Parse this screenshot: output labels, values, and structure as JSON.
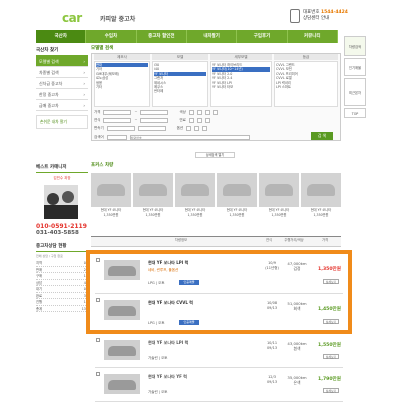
{
  "header": {
    "logo": "car",
    "logo_sub": "카피알 중고차",
    "tel_label": "대표번호",
    "tel": "1544-4424",
    "tel_note": "상담센터 안내"
  },
  "nav": [
    "국산차",
    "수입차",
    "중고차 할인전",
    "내차팔기",
    "구입후기",
    "커뮤니티"
  ],
  "left": {
    "title": "국산차 찾기",
    "items": [
      "모델별 검색",
      "차종별 검색",
      "신차급 중고차",
      "한정 중고차",
      "급매 중고차"
    ],
    "side_title": "손쉬운 내차 팔기",
    "best_title": "베스트 카매니저",
    "best_name": "김민수 과장",
    "phone1": "010-0591-2119",
    "phone2": "031-403-5858",
    "consult_title": "중고차상담 현황",
    "consult_sub": "전체 상담 / 구입 완료",
    "stats": [
      [
        "지역",
        "00"
      ],
      [
        "판매",
        "23"
      ],
      [
        "구매",
        "12"
      ],
      [
        "상담",
        "45"
      ],
      [
        "대기",
        "08"
      ],
      [
        "완료",
        "31"
      ],
      [
        "진행",
        "17"
      ],
      [
        "총계",
        "136"
      ]
    ]
  },
  "search": {
    "title": "모델별 검색",
    "cols": [
      "제조사",
      "모델",
      "세부모델",
      "등급"
    ],
    "makers": [
      "현대",
      "기아",
      "GM대우(쉐보레)",
      "르노삼성",
      "쌍용",
      "기타"
    ],
    "models": [
      "i30",
      "i40",
      "YF 쏘나타",
      "그랜저",
      "제네시스",
      "에쿠스",
      "싼타페"
    ],
    "details": [
      "YF 쏘나타 하이브리드",
      "YF 쏘나타(10~14년)",
      "YF 쏘나타 2.0",
      "YF 쏘나타 2.4",
      "YF 쏘나타 LPI",
      "YF 쏘나타 터보"
    ],
    "grades": [
      "CVVL 그랜드",
      "CVVL 모던",
      "CVVL 프리미어",
      "CVVL 로열",
      "LPI 럭셔리",
      "LPI 스마트"
    ],
    "price_label": "가격",
    "year_label": "연식",
    "color_label": "색상",
    "fuel_label": "연료",
    "gear_label": "변속기",
    "option_label": "옵션",
    "keyword_label": "검색어",
    "keyword_placeholder": "차량번호",
    "btn": "검 색",
    "more_btn": "상세검색 열기"
  },
  "photos": {
    "title": "포커스 차량",
    "items": [
      [
        "현대 YF 쏘나타",
        "1,350만원"
      ],
      [
        "현대 YF 쏘나타",
        "1,350만원"
      ],
      [
        "현대 YF 쏘나타",
        "1,350만원"
      ],
      [
        "현대 YF 쏘나타",
        "1,350만원"
      ],
      [
        "현대 YF 쏘나타",
        "1,350만원"
      ],
      [
        "현대 YF 쏘나타",
        "1,350만원"
      ]
    ]
  },
  "table": {
    "cols": [
      "차량정보",
      "연식",
      "주행거리/색상",
      "가격"
    ],
    "rows": [
      {
        "name": "현대 YF 쏘나타 LPI 럭",
        "opt": "네비, 썬루프, 풀옵션",
        "fuel": "LPG | 오토",
        "badge": "인증매물",
        "yr": "10/9\n(11년형)",
        "km": "47,000km\n검정",
        "price": "1,350만원",
        "price_color": "#e4322b",
        "btn": "상세보기"
      },
      {
        "name": "현대 YF 쏘나타 CVVL 럭",
        "opt": "",
        "fuel": "LPG | 오토",
        "badge": "인증매물",
        "yr": "10/08\n09/13",
        "km": "51,000km\n회색",
        "price": "1,450만원",
        "price_color": "#5a9a22",
        "btn": "상세보기"
      },
      {
        "name": "현대 YF 쏘나타 LPI 럭",
        "opt": "",
        "fuel": "가솔린 | 오토",
        "badge": "",
        "yr": "10/11\n09/13",
        "km": "43,000km\n흰색",
        "price": "1,550만원",
        "price_color": "#5a9a22",
        "btn": "상세보기"
      },
      {
        "name": "현대 YF 쏘나타 YF 럭",
        "opt": "",
        "fuel": "가솔린 | 오토",
        "badge": "",
        "yr": "12/3\n09/13",
        "km": "35,000km\n은색",
        "price": "1,790만원",
        "price_color": "#5a9a22",
        "btn": "상세보기"
      }
    ]
  },
  "right": [
    "차량검색",
    "인기매물",
    "최근본차",
    "TOP"
  ],
  "colors": {
    "green": "#6fa82b",
    "orange": "#f08b1a",
    "red": "#e4322b"
  }
}
